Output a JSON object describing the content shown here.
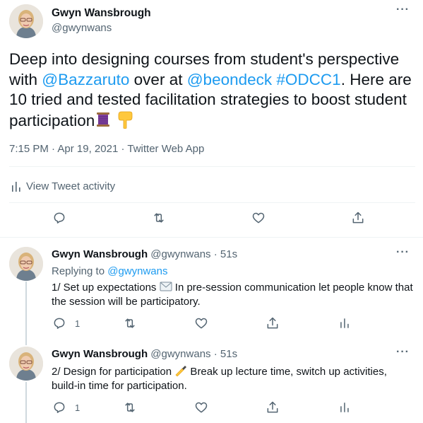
{
  "main_tweet": {
    "author_name": "Gwyn Wansbrough",
    "author_handle": "@gwynwans",
    "more_label": "···",
    "text_part1": "Deep into designing courses from student's perspective with ",
    "mention1": "@Bazzaruto",
    "text_part2": " over at ",
    "mention2": "@beondeck",
    "text_space": " ",
    "hashtag": "#ODCC1",
    "text_part3": ". Here are 10 tried and tested facilitation strategies to boost student participation",
    "time": "7:15 PM",
    "separator": " · ",
    "date": "Apr 19, 2021",
    "app": "Twitter Web App",
    "activity_label": "View Tweet activity"
  },
  "replies": [
    {
      "author_name": "Gwyn Wansbrough",
      "author_handle": "@gwynwans",
      "dot": " · ",
      "time": "51s",
      "replying_prefix": "Replying to ",
      "replying_handle": "@gwynwans",
      "text_before_emoji": "1/ Set up expectations ",
      "text_after_emoji": " In pre-session communication let people know that the session will be participatory.",
      "emoji": "envelope-icon",
      "reply_count": "1",
      "more_label": "···"
    },
    {
      "author_name": "Gwyn Wansbrough",
      "author_handle": "@gwynwans",
      "dot": " · ",
      "time": "51s",
      "text_before_emoji": "2/ Design for participation ",
      "text_after_emoji": " Break up lecture time, switch up activities, build-in time for participation.",
      "emoji": "writing-hand-icon",
      "reply_count": "1",
      "more_label": "···"
    }
  ],
  "colors": {
    "link": "#1d9bf0",
    "secondary_text": "#536471",
    "divider": "#eff3f4",
    "thread_line": "#cfd9de"
  },
  "icons": [
    "reply-icon",
    "retweet-icon",
    "like-icon",
    "share-icon",
    "analytics-icon",
    "thread-emoji-icon",
    "backhand-index-pointing-down-icon"
  ]
}
